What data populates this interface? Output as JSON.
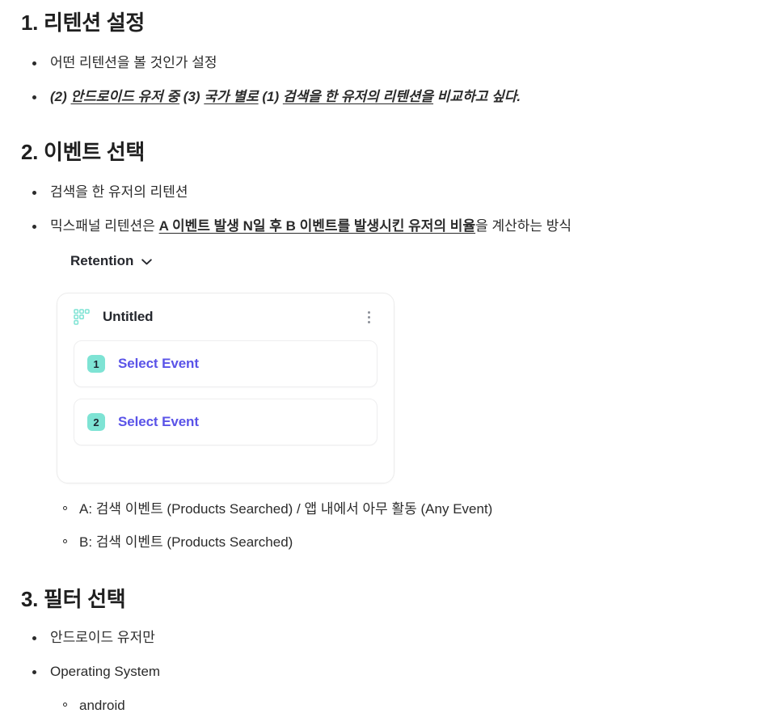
{
  "sections": [
    {
      "heading": "1. 리텐션 설정",
      "bullets": [
        {
          "text": "어떤 리텐션을 볼 것인가 설정"
        }
      ],
      "emphasis_line": {
        "p1": "(2) ",
        "u1": "안드로이드 유저 중",
        "p2": " (3) ",
        "u2": "국가 별로",
        "p3": " (1) ",
        "u3": "검색을 한 유저의 리텐션을",
        "p4": " 비교하고 싶다."
      }
    },
    {
      "heading": "2. 이벤트 선택",
      "bullets": [
        {
          "text": "검색을 한 유저의 리텐션"
        }
      ],
      "mixpanel_line": {
        "pre": "믹스패널 리텐션은 ",
        "strong": "A 이벤트 발생 N일 후 B 이벤트를 발생시킨 유저의 비율",
        "post": "을 계산하는 방식"
      },
      "sub_bullets": [
        {
          "text": "A: 검색 이벤트 (Products Searched) / 앱 내에서 아무 활동 (Any Event)"
        },
        {
          "text": "B: 검색 이벤트 (Products Searched)"
        }
      ]
    },
    {
      "heading": "3. 필터 선택",
      "bullets": [
        {
          "text": "안드로이드 유저만"
        },
        {
          "text": "Operating System"
        }
      ],
      "sub_bullets": [
        {
          "text": "android"
        }
      ]
    }
  ],
  "report_widget": {
    "dropdown_label": "Retention",
    "dropdown_icon": "chevron-down-icon",
    "card": {
      "icon": "retention-grid-icon",
      "title": "Untitled",
      "menu_icon": "kebab-menu-icon",
      "event_rows": [
        {
          "badge": "1",
          "label": "Select Event"
        },
        {
          "badge": "2",
          "label": "Select Event"
        }
      ]
    }
  },
  "colors": {
    "badge_mint": "#7ee3d4",
    "link_purple": "#5a53e8",
    "icon_teal": "#7ee3d4",
    "text_dark": "#2b2b2b"
  }
}
